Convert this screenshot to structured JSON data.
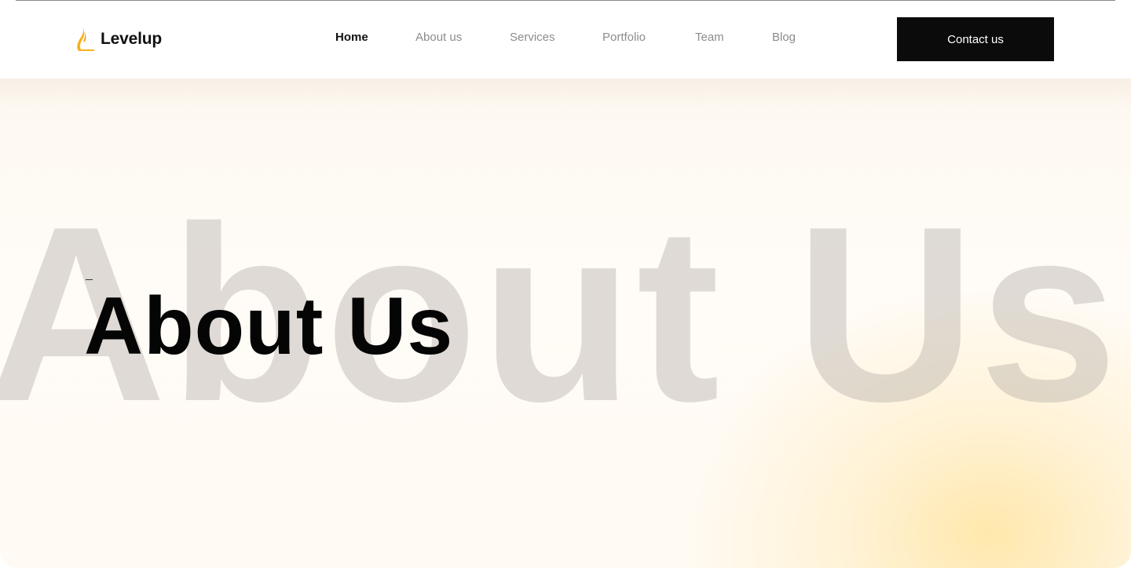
{
  "brand": {
    "name": "Levelup",
    "logo_icon": "levelup-logo-icon",
    "accent_color": "#F7B21B"
  },
  "nav": {
    "items": [
      {
        "label": "Home",
        "active": true
      },
      {
        "label": "About us",
        "active": false
      },
      {
        "label": "Services",
        "active": false
      },
      {
        "label": "Portfolio",
        "active": false
      },
      {
        "label": "Team",
        "active": false
      },
      {
        "label": "Blog",
        "active": false
      }
    ]
  },
  "header": {
    "cta_label": "Contact us",
    "cta_color": "#0B0B0B"
  },
  "hero": {
    "background_text": "About Us",
    "title": "About Us",
    "glow_color": "#FFE5A0"
  }
}
